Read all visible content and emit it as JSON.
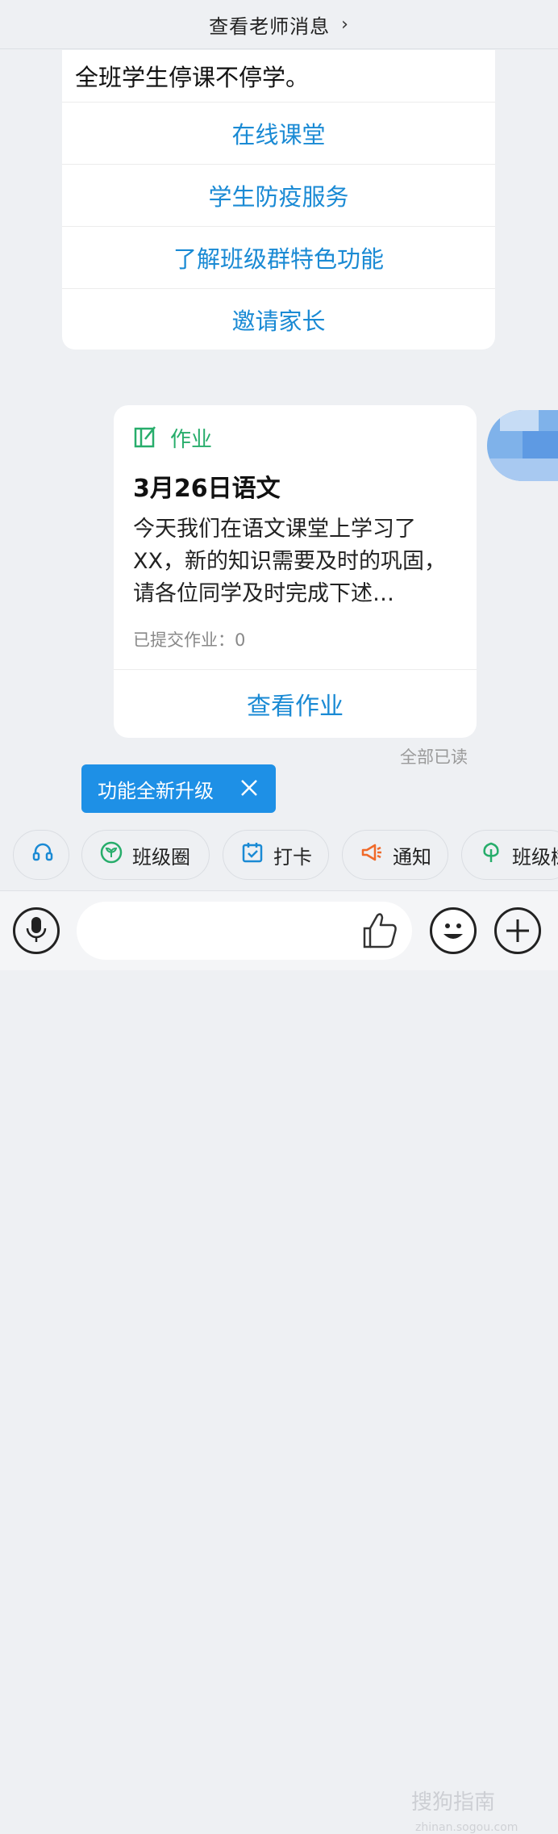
{
  "header": {
    "title": "查看老师消息",
    "chevron": "›"
  },
  "card": {
    "text": "全班学生停课不停学。",
    "links": [
      "在线课堂",
      "学生防疫服务",
      "了解班级群特色功能",
      "邀请家长"
    ]
  },
  "homework": {
    "tag": "作业",
    "title": "3月26日语文",
    "description": "今天我们在语文课堂上学习了XX，新的知识需要及时的巩固，请各位同学及时完成下述…",
    "submitted": "已提交作业：0",
    "view_button": "查看作业",
    "read_status": "全部已读"
  },
  "tooltip": {
    "text": "功能全新升级",
    "close": "✕"
  },
  "quick_actions": [
    {
      "label": "",
      "icon": "headset-icon",
      "color": "#1a8ad4"
    },
    {
      "label": "班级圈",
      "icon": "sprout-icon",
      "color": "#27ad6b"
    },
    {
      "label": "打卡",
      "icon": "calendar-check-icon",
      "color": "#1a8ad4"
    },
    {
      "label": "通知",
      "icon": "megaphone-icon",
      "color": "#f06a2a"
    },
    {
      "label": "班级树",
      "icon": "tree-icon",
      "color": "#27ad6b"
    }
  ],
  "input": {
    "placeholder": ""
  },
  "watermark": {
    "text": "搜狗指南",
    "sub": "zhinan.sogou.com"
  }
}
